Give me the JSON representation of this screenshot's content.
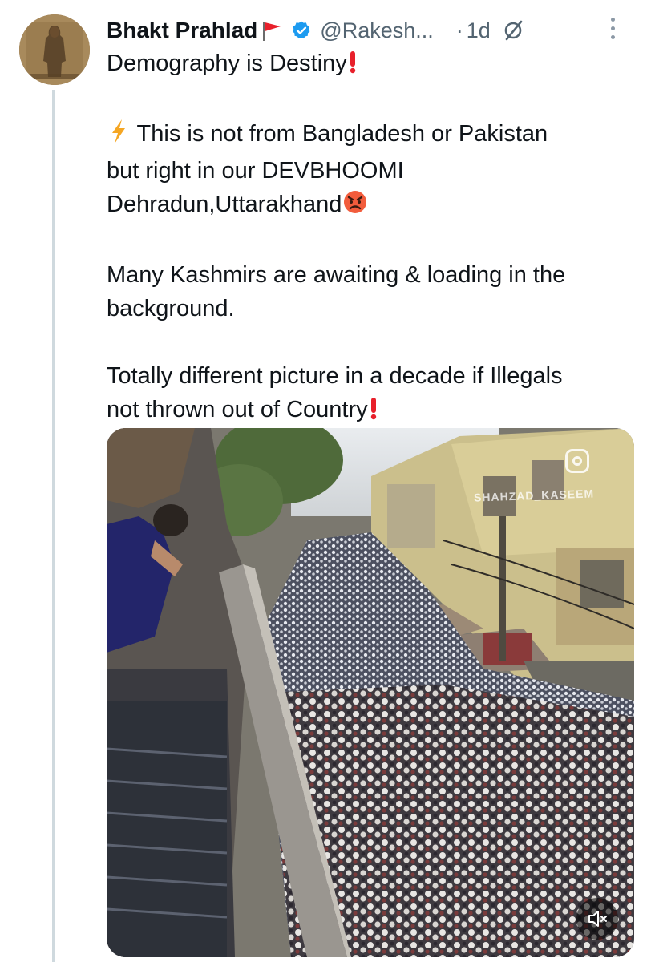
{
  "tweet": {
    "author_name": "Bhakt Prahlad",
    "handle": "@Rakesh...",
    "separator": "·",
    "time": "1d",
    "lines": [
      "Demography is Destiny",
      "This is not from Bangladesh or Pakistan",
      "but right in our DEVBHOOMI",
      "Dehradun,Uttarakhand",
      "Many Kashmirs are awaiting & loading in the",
      "background.",
      "Totally different picture in a decade if Illegals",
      "not thrown out of Country"
    ]
  },
  "media": {
    "watermark": "SHAHZAD_KASEEM"
  },
  "icons": {
    "flag": "red-flag-icon",
    "verified": "verified-badge-icon",
    "grok": "grok-icon",
    "more": "more-options-icon",
    "exclamation": "red-exclamation-icon",
    "lightning": "lightning-icon",
    "angry_face": "angry-face-icon",
    "mute": "muted-speaker-icon",
    "instagram": "instagram-icon"
  },
  "colors": {
    "text": "#0f1419",
    "secondary": "#536471",
    "verified_blue": "#1d9bf0",
    "accent_red": "#e0245e"
  }
}
